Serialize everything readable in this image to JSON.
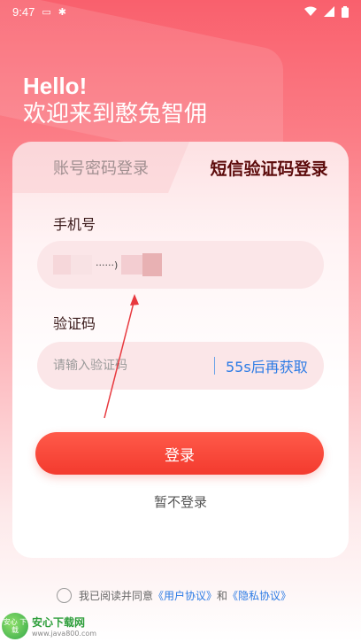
{
  "status_bar": {
    "time": "9:47",
    "icons": [
      "message-icon",
      "bug-icon",
      "wifi-icon",
      "signal-icon",
      "battery-icon"
    ]
  },
  "greeting": {
    "hello": "Hello!",
    "welcome": "欢迎来到憨兔智佣"
  },
  "tabs": [
    {
      "label": "账号密码登录",
      "active": false
    },
    {
      "label": "短信验证码登录",
      "active": true
    }
  ],
  "phone": {
    "label": "手机号",
    "value": "······)"
  },
  "code": {
    "label": "验证码",
    "placeholder": "请输入验证码",
    "resend_label": "55s后再获取"
  },
  "login_button": "登录",
  "skip_login": "暂不登录",
  "agreement": {
    "prefix": "我已阅读并同意",
    "user_agreement": "《用户协议》",
    "and": "和",
    "privacy_policy": "《隐私协议》"
  },
  "watermark": {
    "title": "安心下载网",
    "url": "www.java800.com",
    "badge": "安心 下载"
  },
  "colors": {
    "accent": "#f33a2e",
    "link": "#2c7be5",
    "active_tab": "#5c0b0b"
  }
}
